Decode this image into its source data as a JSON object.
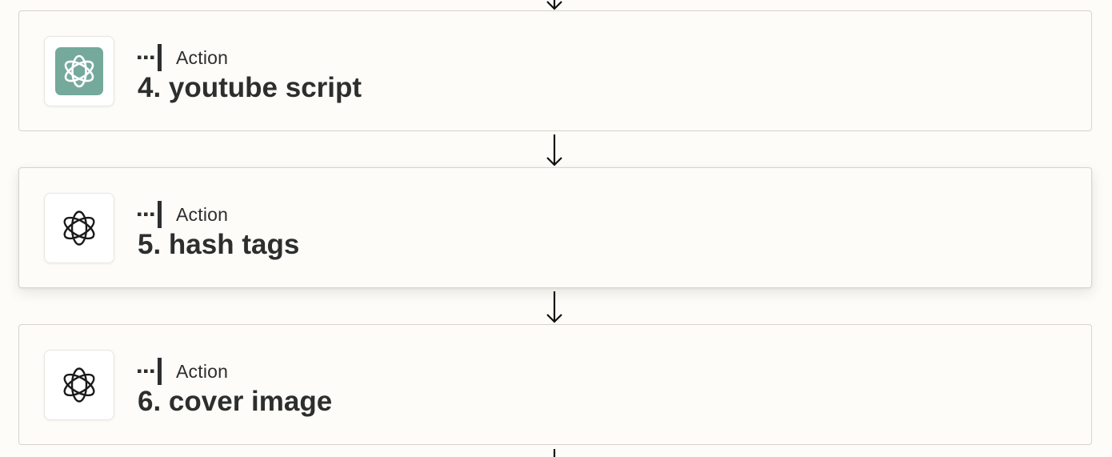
{
  "steps": [
    {
      "type_label": "Action",
      "number": "4.",
      "title": "4. youtube script",
      "icon": "openai-logo-icon",
      "icon_style": "green-tile",
      "icon_color": "#75a99c",
      "hovered": false
    },
    {
      "type_label": "Action",
      "number": "5.",
      "title": "5. hash tags",
      "icon": "openai-logo-icon",
      "icon_style": "plain",
      "hovered": true
    },
    {
      "type_label": "Action",
      "number": "6.",
      "title": "6. cover image",
      "icon": "openai-logo-icon",
      "icon_style": "plain",
      "hovered": false
    }
  ],
  "connector_icon": "down-arrow-icon",
  "action_type_icon": "dashed-branch-icon",
  "colors": {
    "background": "#fdfcf8",
    "card_border": "#d7d4cd",
    "text": "#2d2e2e",
    "openai_tile": "#75a99c"
  }
}
